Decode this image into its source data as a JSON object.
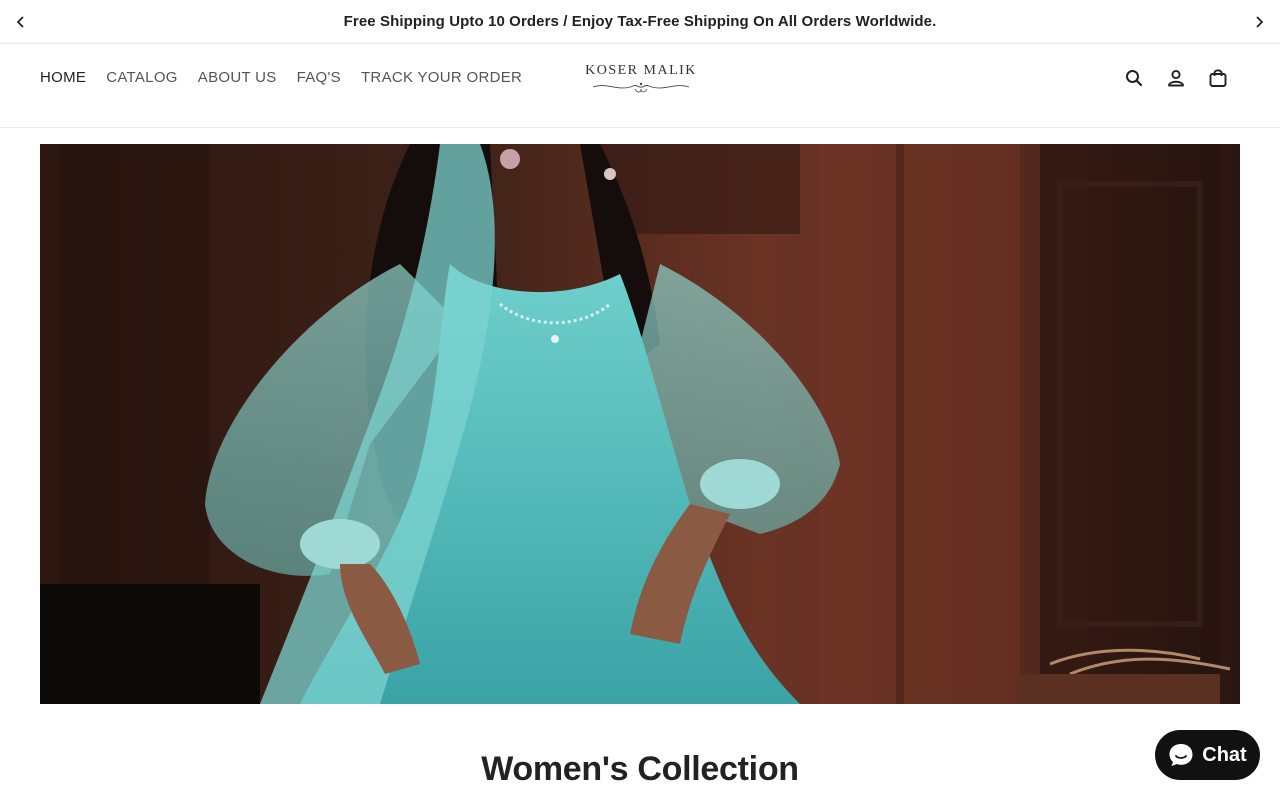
{
  "announcement": {
    "text": "Free Shipping Upto 10 Orders / Enjoy Tax-Free Shipping On All Orders Worldwide.",
    "prev_icon": "chevron-left-icon",
    "next_icon": "chevron-right-icon"
  },
  "nav": {
    "items": [
      {
        "label": "HOME",
        "active": true
      },
      {
        "label": "CATALOG",
        "active": false
      },
      {
        "label": "ABOUT US",
        "active": false
      },
      {
        "label": "FAQ'S",
        "active": false
      },
      {
        "label": "TRACK YOUR ORDER",
        "active": false
      }
    ]
  },
  "logo": {
    "text": "KOSER MALIK"
  },
  "header_icons": {
    "search": "search-icon",
    "account": "account-icon",
    "cart": "cart-icon"
  },
  "hero": {
    "alt": "Model wearing teal embroidered organza outfit"
  },
  "collection": {
    "title": "Women's Collection"
  },
  "chat": {
    "label": "Chat",
    "icon": "chat-bubble-icon"
  },
  "colors": {
    "text": "#222222",
    "chat_bg": "#111111",
    "outfit": "#5fc2c0",
    "background_wood": "#4a2318"
  }
}
